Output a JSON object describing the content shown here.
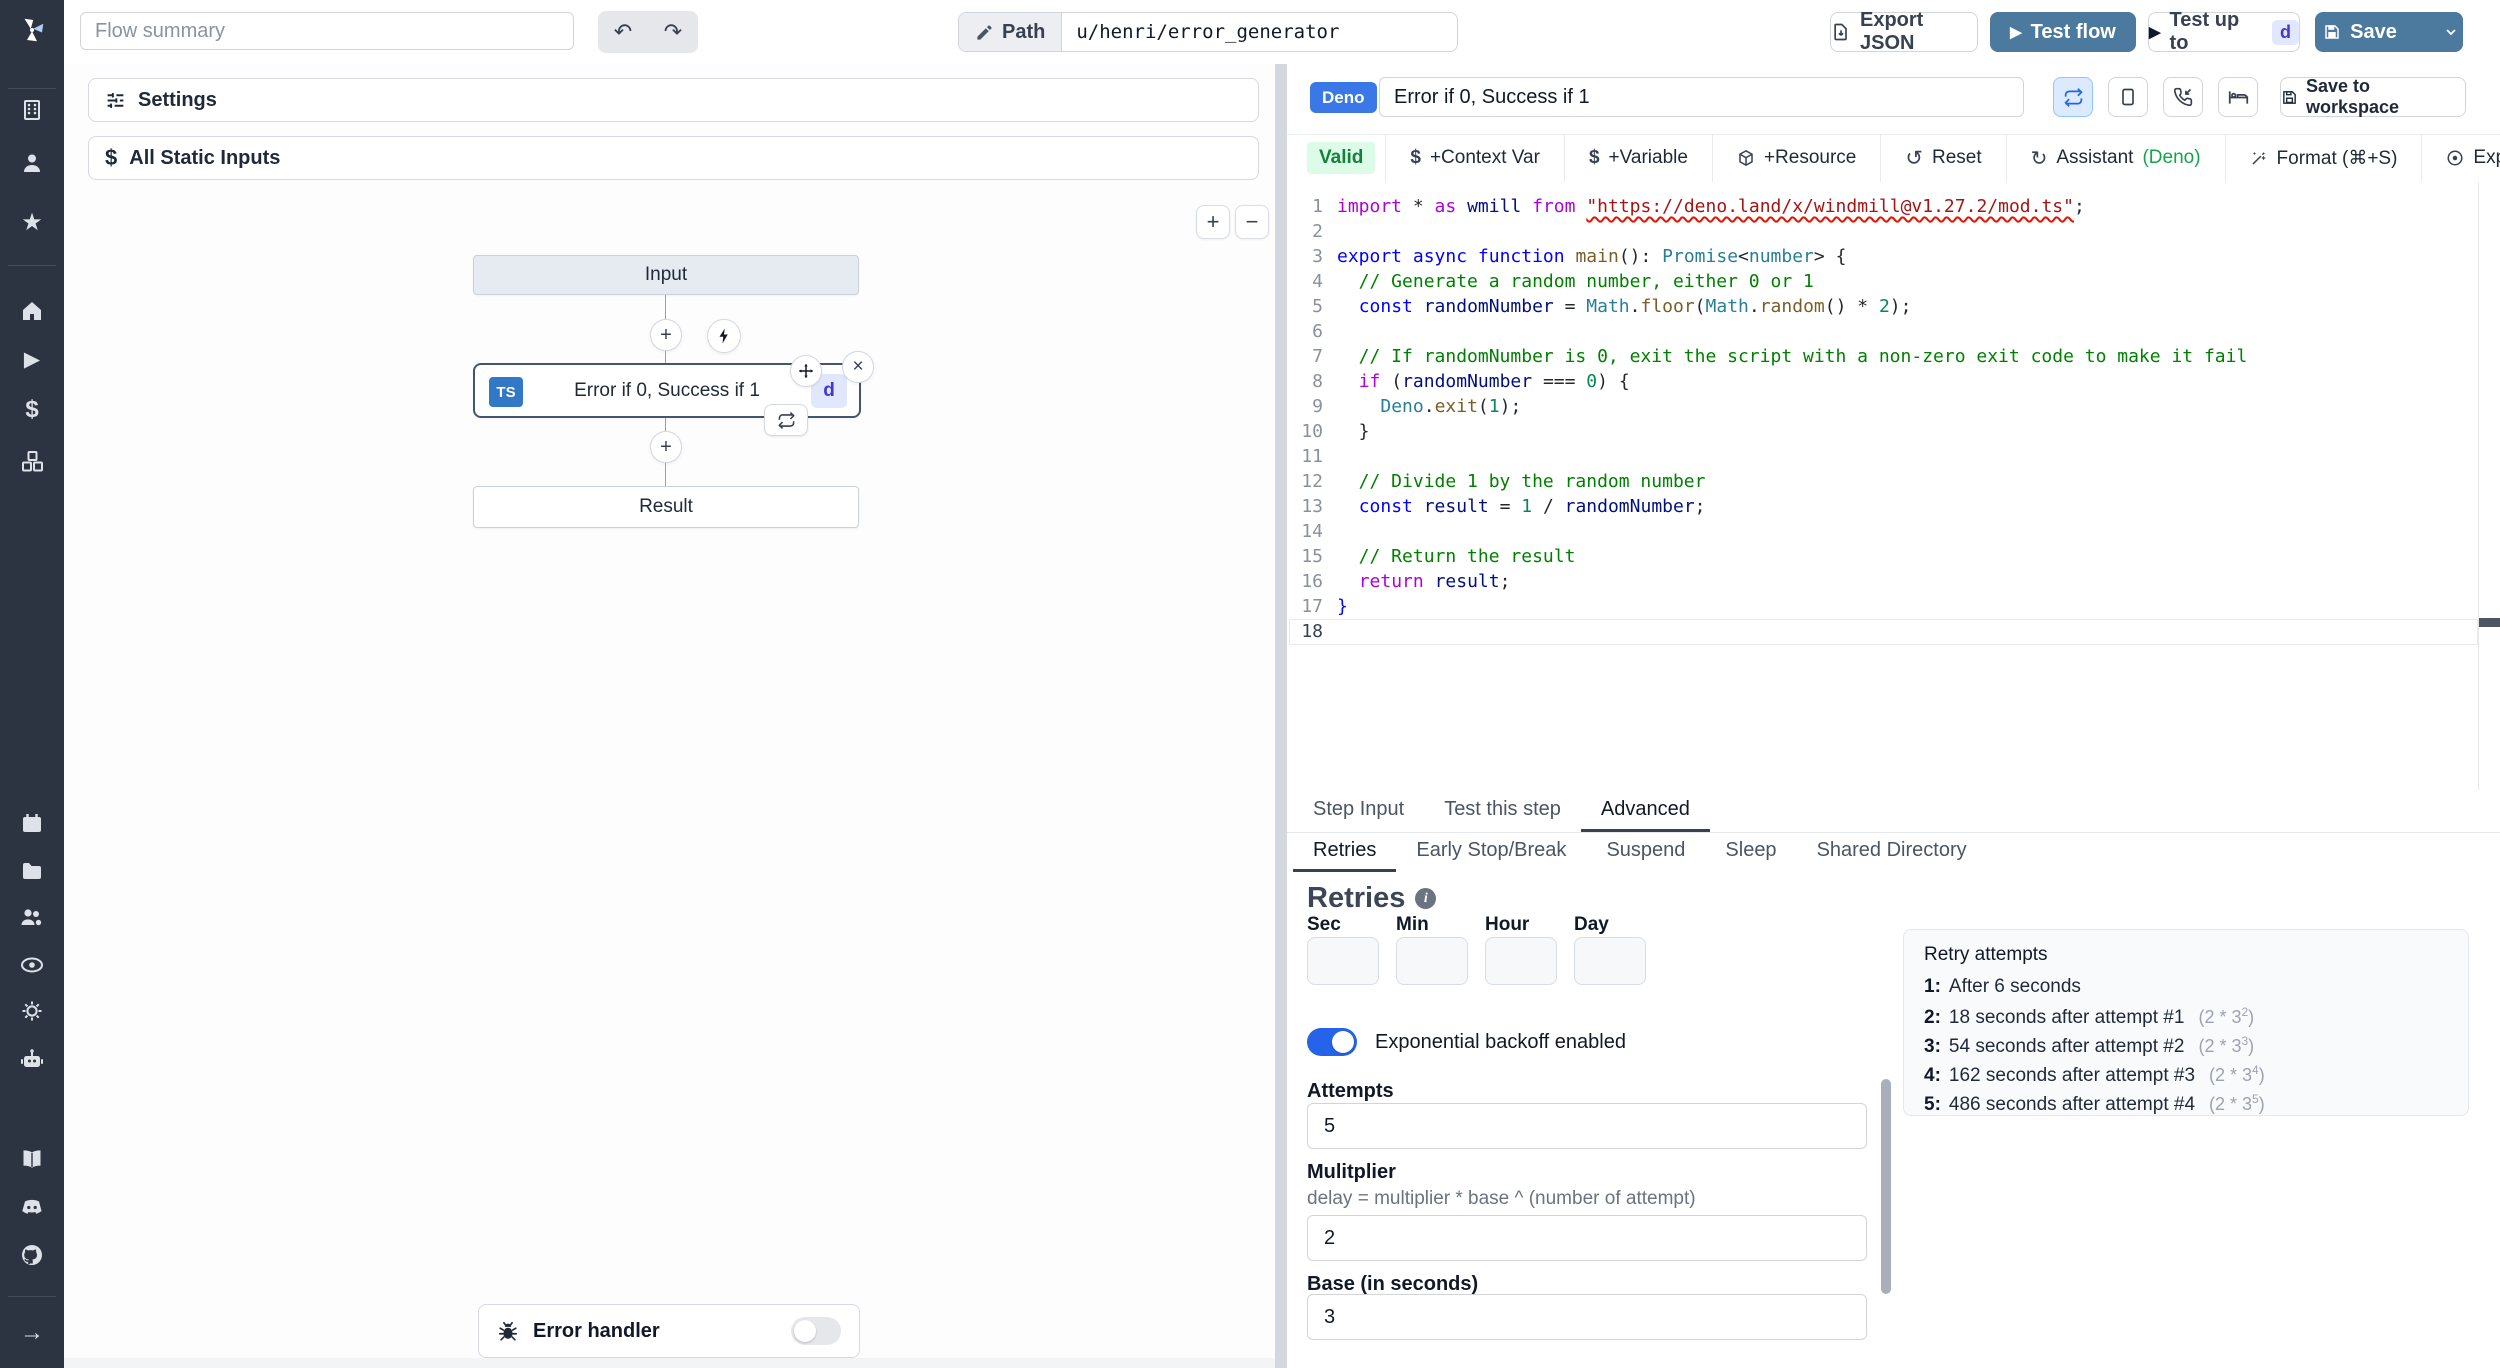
{
  "colors": {
    "sidebar_bg": "#2d3441",
    "primary_button": "#4c7a9f",
    "deno_badge": "#3b78e7",
    "ts_badge": "#3178c6",
    "id_badge_bg": "#e0e7ff",
    "id_badge_text": "#4338ca",
    "valid_bg": "#dcfce7",
    "valid_text": "#15803d",
    "toggle_on": "#2563eb",
    "assistant_green": "#16a34a"
  },
  "topbar": {
    "flow_summary_placeholder": "Flow summary",
    "undo": "↶",
    "redo": "↷",
    "path_label": "Path",
    "path_value": "u/henri/error_generator",
    "export_json": "Export JSON",
    "test_flow": "Test flow",
    "test_up_to": "Test up to",
    "test_up_to_badge": "d",
    "save": "Save"
  },
  "flow_panel": {
    "settings": "Settings",
    "static_inputs": "All Static Inputs",
    "zoom_in": "+",
    "zoom_out": "−",
    "graph": {
      "input_node": "Input",
      "step_node": "Error if 0, Success if 1",
      "step_lang_badge": "TS",
      "step_id_badge": "d",
      "result_node": "Result"
    },
    "error_handler": "Error handler"
  },
  "step": {
    "lang_badge": "Deno",
    "name": "Error if 0, Success if 1",
    "save_to_workspace": "Save to workspace",
    "valid": "Valid",
    "toolbar_items": [
      {
        "icon": "dollar",
        "label": "+Context Var"
      },
      {
        "icon": "dollar",
        "label": "+Variable"
      },
      {
        "icon": "box",
        "label": "+Resource"
      },
      {
        "icon": "reset",
        "label": "Reset"
      },
      {
        "icon": "refresh",
        "label": "Assistant ",
        "suffix": "(Deno)"
      },
      {
        "icon": "wand",
        "label": "Format (⌘+S)"
      },
      {
        "icon": "compass",
        "label": "Explore other s"
      }
    ]
  },
  "editor": {
    "lines": [
      [
        [
          "kP",
          "import"
        ],
        [
          "pl",
          " * "
        ],
        [
          "kP",
          "as"
        ],
        [
          "pl",
          " "
        ],
        [
          "id",
          "wmill"
        ],
        [
          "pl",
          " "
        ],
        [
          "kP",
          "from"
        ],
        [
          "pl",
          " "
        ],
        [
          "strU",
          "\"https://deno.land/x/windmill@v1.27.2/mod.ts\""
        ],
        [
          "pl",
          ";"
        ]
      ],
      [],
      [
        [
          "kB",
          "export"
        ],
        [
          "pl",
          " "
        ],
        [
          "kB",
          "async"
        ],
        [
          "pl",
          " "
        ],
        [
          "kB",
          "function"
        ],
        [
          "pl",
          " "
        ],
        [
          "fn",
          "main"
        ],
        [
          "pl",
          "(): "
        ],
        [
          "ty",
          "Promise"
        ],
        [
          "pl",
          "<"
        ],
        [
          "ty",
          "number"
        ],
        [
          "pl",
          "> {"
        ]
      ],
      [
        [
          "com",
          "  // Generate a random number, either 0 or 1"
        ]
      ],
      [
        [
          "pl",
          "  "
        ],
        [
          "kB",
          "const"
        ],
        [
          "pl",
          " "
        ],
        [
          "id",
          "randomNumber"
        ],
        [
          "pl",
          " = "
        ],
        [
          "ty",
          "Math"
        ],
        [
          "pl",
          "."
        ],
        [
          "fn",
          "floor"
        ],
        [
          "pl",
          "("
        ],
        [
          "ty",
          "Math"
        ],
        [
          "pl",
          "."
        ],
        [
          "fn",
          "random"
        ],
        [
          "pl",
          "() * "
        ],
        [
          "num",
          "2"
        ],
        [
          "pl",
          ");"
        ]
      ],
      [],
      [
        [
          "com",
          "  // If randomNumber is 0, exit the script with a non-zero exit code to make it fail"
        ]
      ],
      [
        [
          "pl",
          "  "
        ],
        [
          "kP",
          "if"
        ],
        [
          "pl",
          " ("
        ],
        [
          "id",
          "randomNumber"
        ],
        [
          "pl",
          " === "
        ],
        [
          "num",
          "0"
        ],
        [
          "pl",
          ") {"
        ]
      ],
      [
        [
          "pl",
          "    "
        ],
        [
          "ty",
          "Deno"
        ],
        [
          "pl",
          "."
        ],
        [
          "fn",
          "exit"
        ],
        [
          "pl",
          "("
        ],
        [
          "num",
          "1"
        ],
        [
          "pl",
          ");"
        ]
      ],
      [
        [
          "pl",
          "  }"
        ]
      ],
      [],
      [
        [
          "com",
          "  // Divide 1 by the random number"
        ]
      ],
      [
        [
          "pl",
          "  "
        ],
        [
          "kB",
          "const"
        ],
        [
          "pl",
          " "
        ],
        [
          "id",
          "result"
        ],
        [
          "pl",
          " = "
        ],
        [
          "num",
          "1"
        ],
        [
          "pl",
          " / "
        ],
        [
          "id",
          "randomNumber"
        ],
        [
          "pl",
          ";"
        ]
      ],
      [],
      [
        [
          "com",
          "  // Return the result"
        ]
      ],
      [
        [
          "pl",
          "  "
        ],
        [
          "kP",
          "return"
        ],
        [
          "pl",
          " "
        ],
        [
          "id",
          "result"
        ],
        [
          "pl",
          ";"
        ]
      ],
      [
        [
          "kB",
          "}"
        ]
      ],
      []
    ]
  },
  "tabs": [
    {
      "label": "Step Input",
      "active": false
    },
    {
      "label": "Test this step",
      "active": false
    },
    {
      "label": "Advanced",
      "active": true
    }
  ],
  "subtabs": [
    {
      "label": "Retries",
      "active": true
    },
    {
      "label": "Early Stop/Break",
      "active": false
    },
    {
      "label": "Suspend",
      "active": false
    },
    {
      "label": "Sleep",
      "active": false
    },
    {
      "label": "Shared Directory",
      "active": false
    }
  ],
  "retries": {
    "heading": "Retries",
    "time_fields": [
      "Sec",
      "Min",
      "Hour",
      "Day"
    ],
    "backoff_label": "Exponential backoff enabled",
    "attempts_label": "Attempts",
    "attempts_value": "5",
    "multiplier_label": "Mulitplier",
    "multiplier_help": "delay = multiplier * base ^ (number of attempt)",
    "multiplier_value": "2",
    "base_label": "Base (in seconds)",
    "base_value": "3",
    "retry_panel": {
      "title": "Retry attempts",
      "items": [
        {
          "n": "1:",
          "text": "After 6 seconds"
        },
        {
          "n": "2:",
          "text": "18 seconds after attempt #1",
          "fb": "2 * 3",
          "fe": "2"
        },
        {
          "n": "3:",
          "text": "54 seconds after attempt #2",
          "fb": "2 * 3",
          "fe": "3"
        },
        {
          "n": "4:",
          "text": "162 seconds after attempt #3",
          "fb": "2 * 3",
          "fe": "4"
        },
        {
          "n": "5:",
          "text": "486 seconds after attempt #4",
          "fb": "2 * 3",
          "fe": "5"
        }
      ]
    }
  }
}
